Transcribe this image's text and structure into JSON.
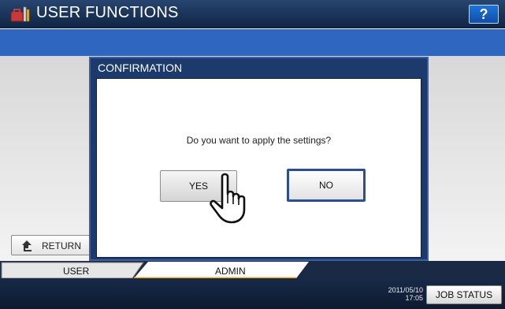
{
  "header": {
    "title": "USER FUNCTIONS",
    "help_label": "?"
  },
  "dialog": {
    "title": "CONFIRMATION",
    "message": "Do you want to apply the settings?",
    "yes_label": "YES",
    "no_label": "NO"
  },
  "return_label": "RETURN",
  "tabs": [
    {
      "label": "USER",
      "active": false
    },
    {
      "label": "ADMIN",
      "active": true
    }
  ],
  "status": {
    "date": "2011/05/10",
    "time": "17:05",
    "job_status_label": "JOB STATUS"
  },
  "colors": {
    "title_bar": "#0f2545",
    "blue_band": "#2f66bf",
    "dialog_frame": "#1c3a6b",
    "active_tab": "#f0a81c",
    "help_button": "#1e74d8"
  },
  "icons": {
    "app": "toolbox-icon",
    "return": "return-arrow-icon",
    "pointer": "hand-pointer-icon"
  }
}
